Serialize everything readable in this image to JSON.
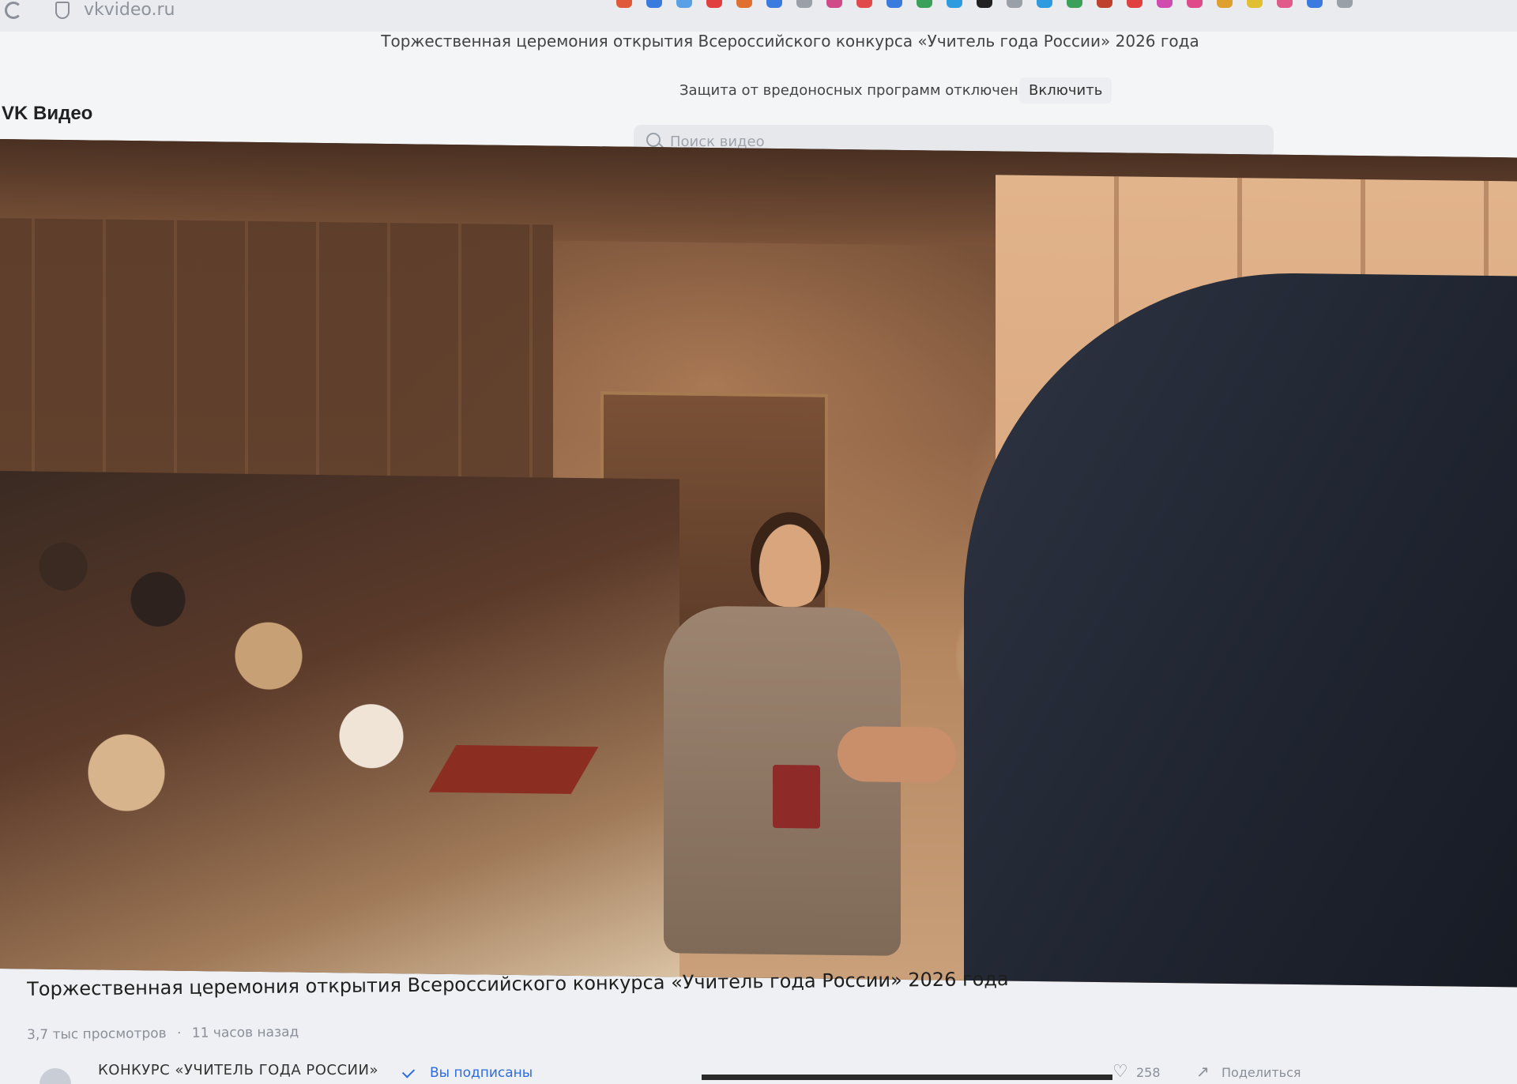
{
  "browser": {
    "url": "vkvideo.ru",
    "extension_colors": [
      "#e05a3a",
      "#3b7be0",
      "#5aa0e6",
      "#e04040",
      "#e07030",
      "#3b7be0",
      "#9aa0a8",
      "#d04a8a",
      "#e04a4a",
      "#3b7be0",
      "#3aa05a",
      "#2e9ae0",
      "#222222",
      "#9aa0a8",
      "#2e9ae0",
      "#3aa05a",
      "#c0402e",
      "#e04040",
      "#d04ab0",
      "#e04a8a",
      "#e0a030",
      "#e0c030",
      "#e05a8a",
      "#3b7be0",
      "#9aa0a8"
    ]
  },
  "tab_title": "Торжественная церемония открытия Всероссийского конкурса «Учитель года России» 2026 года",
  "header": {
    "logo": "VK Видео",
    "protection_notice": "Защита от вредоносных программ отключена",
    "enable_button": "Включить",
    "search_placeholder": "Поиск видео"
  },
  "video": {
    "title": "Торжественная церемония открытия Всероссийского конкурса «Учитель года России» 2026 года",
    "views": "3,7 тыс просмотров",
    "separator": "·",
    "posted": "11 часов назад",
    "channel_name": "КОНКУРС «УЧИТЕЛЬ ГОДА РОССИИ»",
    "subscribed_label": "Вы подписаны",
    "likes": "258",
    "share_label": "Поделиться"
  },
  "icons": {
    "reload": "reload-icon",
    "shield": "shield-icon",
    "search": "search-icon",
    "check": "check-icon",
    "like": "heart-icon",
    "share": "share-icon"
  }
}
